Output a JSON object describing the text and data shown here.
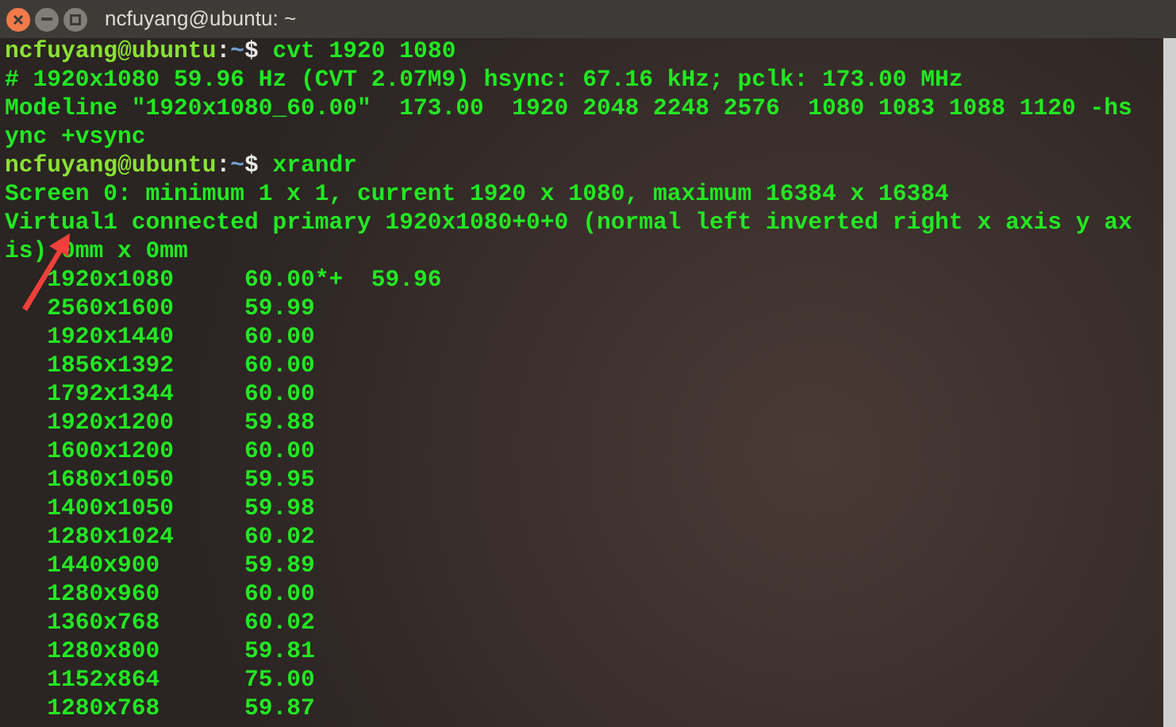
{
  "window": {
    "title": "ncfuyang@ubuntu: ~"
  },
  "lines": [
    {
      "kind": "prompt",
      "user_host": "ncfuyang@ubuntu",
      "colon": ":",
      "path": "~",
      "symbol": "$",
      "command": "cvt 1920 1080"
    },
    {
      "kind": "output",
      "text": "# 1920x1080 59.96 Hz (CVT 2.07M9) hsync: 67.16 kHz; pclk: 173.00 MHz"
    },
    {
      "kind": "output",
      "text": "Modeline \"1920x1080_60.00\"  173.00  1920 2048 2248 2576  1080 1083 1088 1120 -hs"
    },
    {
      "kind": "output",
      "text": "ync +vsync"
    },
    {
      "kind": "prompt",
      "user_host": "ncfuyang@ubuntu",
      "colon": ":",
      "path": "~",
      "symbol": "$",
      "command": "xrandr"
    },
    {
      "kind": "output",
      "text": "Screen 0: minimum 1 x 1, current 1920 x 1080, maximum 16384 x 16384"
    },
    {
      "kind": "output",
      "text": "Virtual1 connected primary 1920x1080+0+0 (normal left inverted right x axis y ax"
    },
    {
      "kind": "output",
      "text": "is) 0mm x 0mm"
    },
    {
      "kind": "mode",
      "resolution": "1920x1080",
      "rates": "60.00*+  59.96"
    },
    {
      "kind": "mode",
      "resolution": "2560x1600",
      "rates": "59.99"
    },
    {
      "kind": "mode",
      "resolution": "1920x1440",
      "rates": "60.00"
    },
    {
      "kind": "mode",
      "resolution": "1856x1392",
      "rates": "60.00"
    },
    {
      "kind": "mode",
      "resolution": "1792x1344",
      "rates": "60.00"
    },
    {
      "kind": "mode",
      "resolution": "1920x1200",
      "rates": "59.88"
    },
    {
      "kind": "mode",
      "resolution": "1600x1200",
      "rates": "60.00"
    },
    {
      "kind": "mode",
      "resolution": "1680x1050",
      "rates": "59.95"
    },
    {
      "kind": "mode",
      "resolution": "1400x1050",
      "rates": "59.98"
    },
    {
      "kind": "mode",
      "resolution": "1280x1024",
      "rates": "60.02"
    },
    {
      "kind": "mode",
      "resolution": "1440x900",
      "rates": "59.89"
    },
    {
      "kind": "mode",
      "resolution": "1280x960",
      "rates": "60.00"
    },
    {
      "kind": "mode",
      "resolution": "1360x768",
      "rates": "60.02"
    },
    {
      "kind": "mode",
      "resolution": "1280x800",
      "rates": "59.81"
    },
    {
      "kind": "mode",
      "resolution": "1152x864",
      "rates": "75.00"
    },
    {
      "kind": "mode",
      "resolution": "1280x768",
      "rates": "59.87"
    }
  ]
}
